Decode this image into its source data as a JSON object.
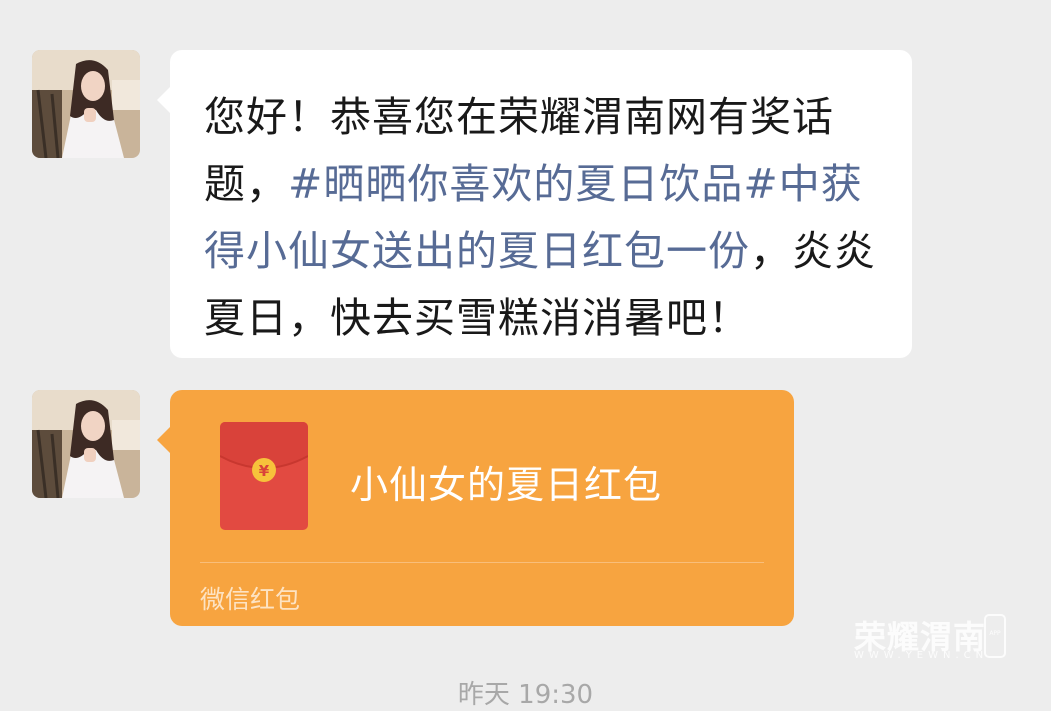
{
  "messages": [
    {
      "text_parts": [
        "您好！恭喜您在荣耀渭南网有奖话题，",
        "#晒晒你喜欢的夏日饮品#中获得小仙女送出的夏日红包一份",
        "，炎炎夏日，快去买雪糕消消暑吧！"
      ]
    },
    {
      "red_packet": {
        "title": "小仙女的夏日红包",
        "source": "微信红包",
        "icon": "yuan-coin-icon",
        "coin_symbol": "¥"
      }
    }
  ],
  "timestamp": "昨天 19:30",
  "watermark": {
    "brand": "荣耀渭南",
    "url": "WWW.YEWN.CN",
    "badge": "APP"
  },
  "colors": {
    "background": "#ededed",
    "bubble": "#ffffff",
    "hashtag": "#576b95",
    "red_packet": "#f7a440",
    "envelope": "#e24a41",
    "coin": "#f7c23b"
  }
}
